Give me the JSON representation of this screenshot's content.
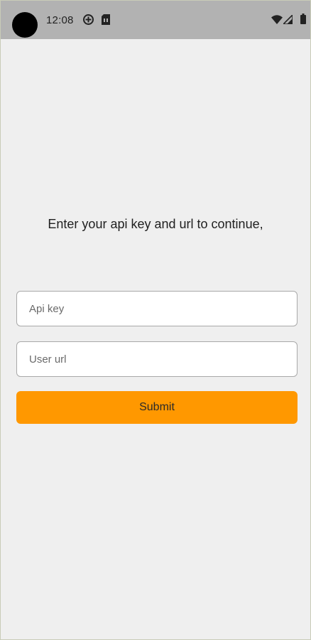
{
  "status_bar": {
    "time": "12:08",
    "left_icons": [
      "data-saver-icon",
      "sim-card-icon"
    ],
    "right_icons": [
      "wifi-icon",
      "signal-icon",
      "battery-icon"
    ]
  },
  "main": {
    "prompt": "Enter your api key and url to continue,",
    "api_key_field": {
      "value": "",
      "placeholder": "Api key"
    },
    "user_url_field": {
      "value": "",
      "placeholder": "User url"
    },
    "submit_label": "Submit"
  },
  "colors": {
    "background": "#efefef",
    "status_bar": "#b2b2b2",
    "accent": "#ff9800"
  }
}
